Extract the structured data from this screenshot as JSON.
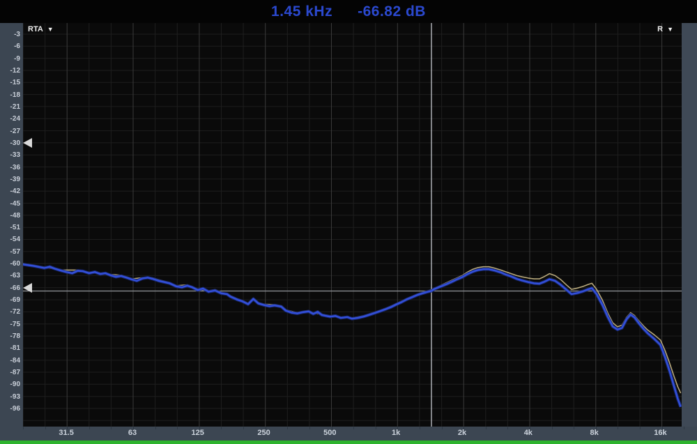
{
  "header": {
    "freq_readout": "1.45 kHz",
    "level_readout": "-66.82 dB"
  },
  "controls": {
    "rta_dropdown": {
      "label": "RTA",
      "arrow": "▼"
    },
    "channel_dropdown": {
      "label": "R",
      "arrow": "▼"
    }
  },
  "colors": {
    "readout_text": "#2b49cf",
    "panel_gutter": "#3c4652",
    "plot_background": "#0a0a0a",
    "grid_minor": "#1e1e1e",
    "grid_major": "#3a3a3a",
    "crosshair_vertical": "#c3c7cd",
    "crosshair_horizontal": "#969aa0",
    "trace_blue": "#3350dc",
    "trace_blue_glow": "#1b2b7a",
    "trace_overlay": "#b8a97c",
    "marker": "#d9d9d9",
    "signal_meter_green": "#2db32d",
    "axis_label_text": "#ccd3dc"
  },
  "chart_data": {
    "type": "line",
    "title": "",
    "x_scale": "log",
    "x_unit": "Hz",
    "y_unit": "dB",
    "x_range": [
      20,
      20000
    ],
    "y_range": [
      -99,
      0
    ],
    "grid": "on",
    "y_tick_step": 3,
    "y_tick_labels": [
      "-3",
      "-6",
      "-9",
      "-12",
      "-15",
      "-18",
      "-21",
      "-24",
      "-27",
      "-30",
      "-33",
      "-36",
      "-39",
      "-42",
      "-45",
      "-48",
      "-51",
      "-54",
      "-57",
      "-60",
      "-63",
      "-66",
      "-69",
      "-72",
      "-75",
      "-78",
      "-81",
      "-84",
      "-87",
      "-90",
      "-93",
      "-96"
    ],
    "x_ticks": [
      {
        "label": "31.5",
        "hz": 31.5
      },
      {
        "label": "63",
        "hz": 63
      },
      {
        "label": "125",
        "hz": 125
      },
      {
        "label": "250",
        "hz": 250
      },
      {
        "label": "500",
        "hz": 500
      },
      {
        "label": "1k",
        "hz": 1000
      },
      {
        "label": "2k",
        "hz": 2000
      },
      {
        "label": "4k",
        "hz": 4000
      },
      {
        "label": "8k",
        "hz": 8000
      },
      {
        "label": "16k",
        "hz": 16000
      }
    ],
    "crosshair": {
      "freq_hz": 1450,
      "level_db": -66.82
    },
    "level_markers_db": [
      -30,
      -66
    ],
    "series": [
      {
        "name": "overlay-trace",
        "color": "#b8a97c",
        "points": [
          [
            20,
            -60.0
          ],
          [
            25,
            -60.9
          ],
          [
            30,
            -61.6
          ],
          [
            35.5,
            -61.6
          ],
          [
            40,
            -62.2
          ],
          [
            45,
            -62.4
          ],
          [
            50,
            -62.7
          ],
          [
            56,
            -62.9
          ],
          [
            63,
            -63.8
          ],
          [
            70,
            -63.5
          ],
          [
            78,
            -63.6
          ],
          [
            88,
            -64.4
          ],
          [
            100,
            -65.5
          ],
          [
            112,
            -65.3
          ],
          [
            125,
            -66.4
          ],
          [
            140,
            -66.8
          ],
          [
            150,
            -66.5
          ],
          [
            160,
            -67.2
          ],
          [
            176,
            -68.0
          ],
          [
            190,
            -68.8
          ],
          [
            200,
            -69.2
          ],
          [
            212,
            -69.9
          ],
          [
            224,
            -68.6
          ],
          [
            236,
            -69.7
          ],
          [
            250,
            -70.1
          ],
          [
            280,
            -70.2
          ],
          [
            300,
            -70.5
          ],
          [
            315,
            -71.5
          ],
          [
            355,
            -72.2
          ],
          [
            400,
            -71.7
          ],
          [
            420,
            -72.3
          ],
          [
            460,
            -72.6
          ],
          [
            500,
            -73.0
          ],
          [
            560,
            -73.3
          ],
          [
            630,
            -73.5
          ],
          [
            710,
            -73.0
          ],
          [
            800,
            -72.1
          ],
          [
            900,
            -71.1
          ],
          [
            1000,
            -70.0
          ],
          [
            1120,
            -68.7
          ],
          [
            1250,
            -67.6
          ],
          [
            1450,
            -66.5
          ],
          [
            1600,
            -65.4
          ],
          [
            1800,
            -64.1
          ],
          [
            2000,
            -63.0
          ],
          [
            2120,
            -62.1
          ],
          [
            2240,
            -61.4
          ],
          [
            2360,
            -61.0
          ],
          [
            2500,
            -60.8
          ],
          [
            2650,
            -60.8
          ],
          [
            2800,
            -61.1
          ],
          [
            3000,
            -61.6
          ],
          [
            3150,
            -62.0
          ],
          [
            3350,
            -62.5
          ],
          [
            3550,
            -63.0
          ],
          [
            3750,
            -63.3
          ],
          [
            4000,
            -63.6
          ],
          [
            4250,
            -63.8
          ],
          [
            4500,
            -63.8
          ],
          [
            4750,
            -63.2
          ],
          [
            5000,
            -62.5
          ],
          [
            5300,
            -63.0
          ],
          [
            5600,
            -63.9
          ],
          [
            6000,
            -65.4
          ],
          [
            6300,
            -66.4
          ],
          [
            6700,
            -66.1
          ],
          [
            7100,
            -65.7
          ],
          [
            7500,
            -65.2
          ],
          [
            7800,
            -64.9
          ],
          [
            8200,
            -66.4
          ],
          [
            8700,
            -69.0
          ],
          [
            9200,
            -72.2
          ],
          [
            9700,
            -74.7
          ],
          [
            10200,
            -75.7
          ],
          [
            10700,
            -75.3
          ],
          [
            11200,
            -73.4
          ],
          [
            11700,
            -72.2
          ],
          [
            12200,
            -72.9
          ],
          [
            12800,
            -74.3
          ],
          [
            13400,
            -75.5
          ],
          [
            14000,
            -76.5
          ],
          [
            15000,
            -77.7
          ],
          [
            16000,
            -79.0
          ],
          [
            16800,
            -81.6
          ],
          [
            17600,
            -84.6
          ],
          [
            18400,
            -87.8
          ],
          [
            19200,
            -90.6
          ],
          [
            19800,
            -92.2
          ]
        ]
      },
      {
        "name": "rta-trace",
        "color": "#3350dc",
        "points": [
          [
            20,
            -60.2
          ],
          [
            22.4,
            -60.6
          ],
          [
            25,
            -61.1
          ],
          [
            26.5,
            -60.8
          ],
          [
            28,
            -61.3
          ],
          [
            30,
            -61.8
          ],
          [
            31.5,
            -62.1
          ],
          [
            33.5,
            -62.4
          ],
          [
            35.5,
            -61.8
          ],
          [
            37.5,
            -61.9
          ],
          [
            40,
            -62.4
          ],
          [
            42.5,
            -62.1
          ],
          [
            45,
            -62.6
          ],
          [
            47.5,
            -62.4
          ],
          [
            50,
            -62.9
          ],
          [
            53,
            -63.3
          ],
          [
            56,
            -63.1
          ],
          [
            60,
            -63.6
          ],
          [
            63,
            -64.0
          ],
          [
            66,
            -64.3
          ],
          [
            70,
            -63.7
          ],
          [
            74,
            -63.5
          ],
          [
            78,
            -63.8
          ],
          [
            83,
            -64.3
          ],
          [
            88,
            -64.6
          ],
          [
            93,
            -64.9
          ],
          [
            100,
            -65.7
          ],
          [
            106,
            -65.9
          ],
          [
            112,
            -65.5
          ],
          [
            118,
            -65.9
          ],
          [
            125,
            -66.6
          ],
          [
            132,
            -66.2
          ],
          [
            140,
            -67.0
          ],
          [
            150,
            -66.7
          ],
          [
            160,
            -67.4
          ],
          [
            170,
            -67.6
          ],
          [
            176,
            -68.2
          ],
          [
            190,
            -69.0
          ],
          [
            200,
            -69.4
          ],
          [
            212,
            -70.1
          ],
          [
            224,
            -68.8
          ],
          [
            236,
            -69.9
          ],
          [
            250,
            -70.3
          ],
          [
            265,
            -70.6
          ],
          [
            280,
            -70.4
          ],
          [
            300,
            -70.7
          ],
          [
            315,
            -71.7
          ],
          [
            335,
            -72.2
          ],
          [
            355,
            -72.4
          ],
          [
            375,
            -72.1
          ],
          [
            400,
            -71.9
          ],
          [
            420,
            -72.5
          ],
          [
            440,
            -72.0
          ],
          [
            460,
            -72.8
          ],
          [
            500,
            -73.2
          ],
          [
            530,
            -73.0
          ],
          [
            560,
            -73.5
          ],
          [
            600,
            -73.3
          ],
          [
            630,
            -73.7
          ],
          [
            670,
            -73.5
          ],
          [
            710,
            -73.2
          ],
          [
            750,
            -72.8
          ],
          [
            800,
            -72.3
          ],
          [
            850,
            -71.8
          ],
          [
            900,
            -71.3
          ],
          [
            950,
            -70.8
          ],
          [
            1000,
            -70.2
          ],
          [
            1060,
            -69.6
          ],
          [
            1120,
            -68.9
          ],
          [
            1180,
            -68.4
          ],
          [
            1250,
            -67.8
          ],
          [
            1320,
            -67.4
          ],
          [
            1400,
            -67.0
          ],
          [
            1450,
            -66.8
          ],
          [
            1500,
            -66.3
          ],
          [
            1600,
            -65.7
          ],
          [
            1700,
            -65.1
          ],
          [
            1800,
            -64.5
          ],
          [
            1900,
            -63.9
          ],
          [
            2000,
            -63.4
          ],
          [
            2120,
            -62.6
          ],
          [
            2240,
            -62.0
          ],
          [
            2360,
            -61.6
          ],
          [
            2500,
            -61.4
          ],
          [
            2650,
            -61.4
          ],
          [
            2800,
            -61.7
          ],
          [
            3000,
            -62.2
          ],
          [
            3150,
            -62.7
          ],
          [
            3350,
            -63.2
          ],
          [
            3550,
            -63.8
          ],
          [
            3750,
            -64.2
          ],
          [
            4000,
            -64.6
          ],
          [
            4250,
            -64.9
          ],
          [
            4500,
            -65.0
          ],
          [
            4750,
            -64.5
          ],
          [
            5000,
            -63.9
          ],
          [
            5300,
            -64.3
          ],
          [
            5600,
            -65.2
          ],
          [
            6000,
            -66.6
          ],
          [
            6300,
            -67.6
          ],
          [
            6700,
            -67.3
          ],
          [
            7100,
            -66.9
          ],
          [
            7500,
            -66.4
          ],
          [
            7800,
            -66.1
          ],
          [
            8200,
            -67.6
          ],
          [
            8700,
            -70.2
          ],
          [
            9200,
            -73.2
          ],
          [
            9700,
            -75.6
          ],
          [
            10200,
            -76.4
          ],
          [
            10700,
            -76.0
          ],
          [
            11200,
            -73.9
          ],
          [
            11700,
            -72.7
          ],
          [
            12200,
            -73.4
          ],
          [
            12800,
            -74.9
          ],
          [
            13400,
            -76.2
          ],
          [
            14000,
            -77.3
          ],
          [
            15000,
            -78.7
          ],
          [
            16000,
            -80.2
          ],
          [
            16800,
            -83.2
          ],
          [
            17600,
            -86.6
          ],
          [
            18400,
            -90.2
          ],
          [
            19200,
            -93.6
          ],
          [
            19800,
            -95.6
          ]
        ]
      }
    ]
  }
}
